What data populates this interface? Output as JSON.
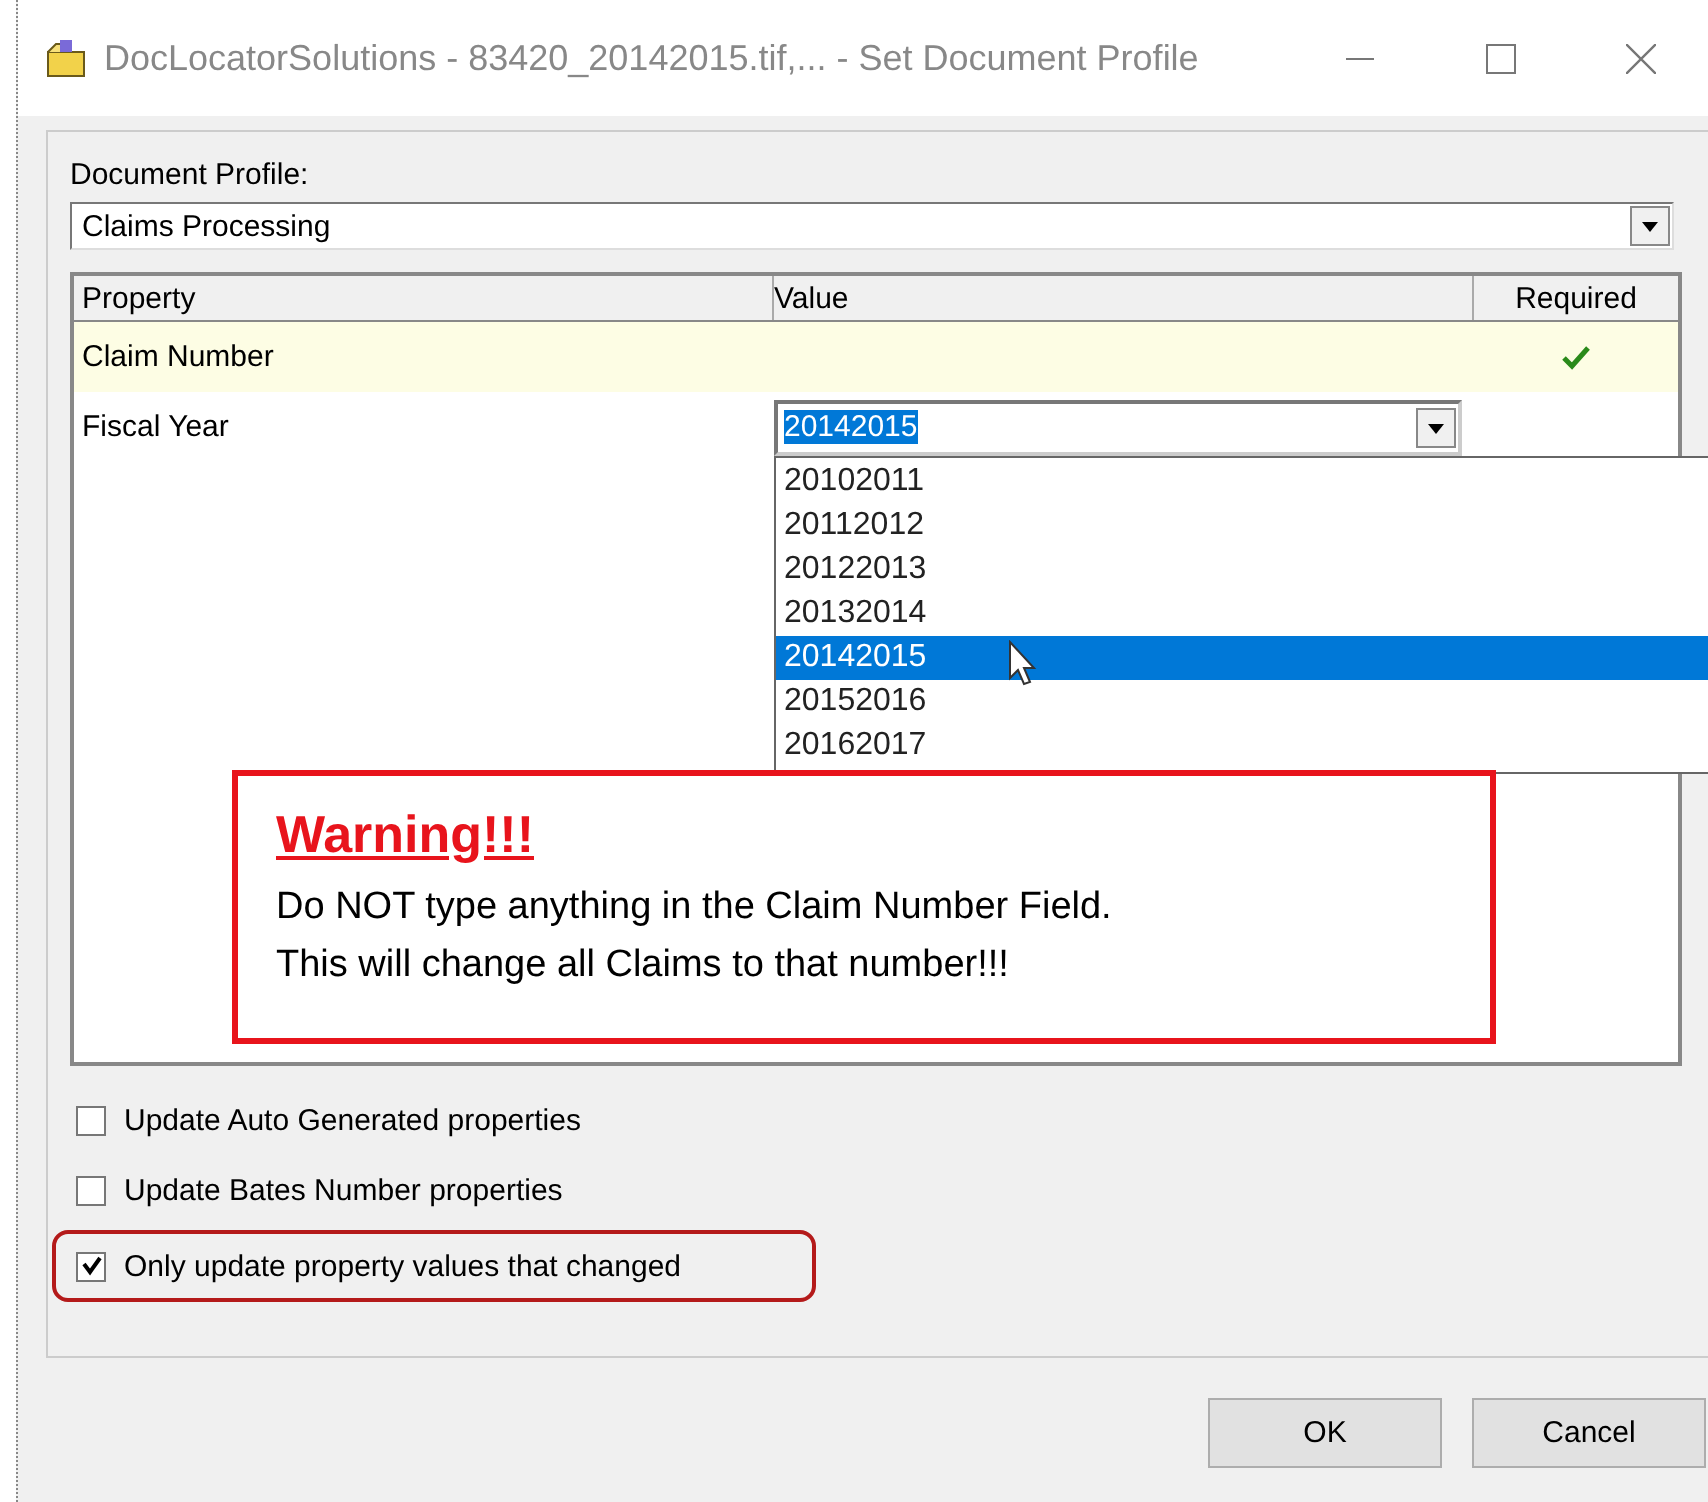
{
  "window": {
    "title": "DocLocatorSolutions - 83420_20142015.tif,... - Set Document Profile"
  },
  "profile": {
    "label": "Document Profile:",
    "value": "Claims Processing"
  },
  "grid": {
    "columns": [
      "Property",
      "Value",
      "Required"
    ],
    "rows": [
      {
        "property": "Claim Number",
        "required": true,
        "selected": true
      },
      {
        "property": "Fiscal Year",
        "required": false,
        "selected": false,
        "editor": {
          "value": "20142015",
          "options": [
            {
              "label": "20102011",
              "selected": false
            },
            {
              "label": "20112012",
              "selected": false
            },
            {
              "label": "20122013",
              "selected": false
            },
            {
              "label": "20132014",
              "selected": false
            },
            {
              "label": "20142015",
              "selected": true
            },
            {
              "label": "20152016",
              "selected": false
            },
            {
              "label": "20162017",
              "selected": false
            }
          ]
        }
      }
    ]
  },
  "warning": {
    "title": "Warning!!!",
    "lines": [
      "Do NOT type anything in the Claim Number Field.",
      "This will change all Claims to that number!!!"
    ]
  },
  "options": [
    {
      "label": "Update Auto Generated properties",
      "checked": false,
      "highlighted": false
    },
    {
      "label": "Update Bates Number properties",
      "checked": false,
      "highlighted": false
    },
    {
      "label": "Only update property values that changed",
      "checked": true,
      "highlighted": true
    }
  ],
  "buttons": [
    "OK",
    "Cancel"
  ]
}
